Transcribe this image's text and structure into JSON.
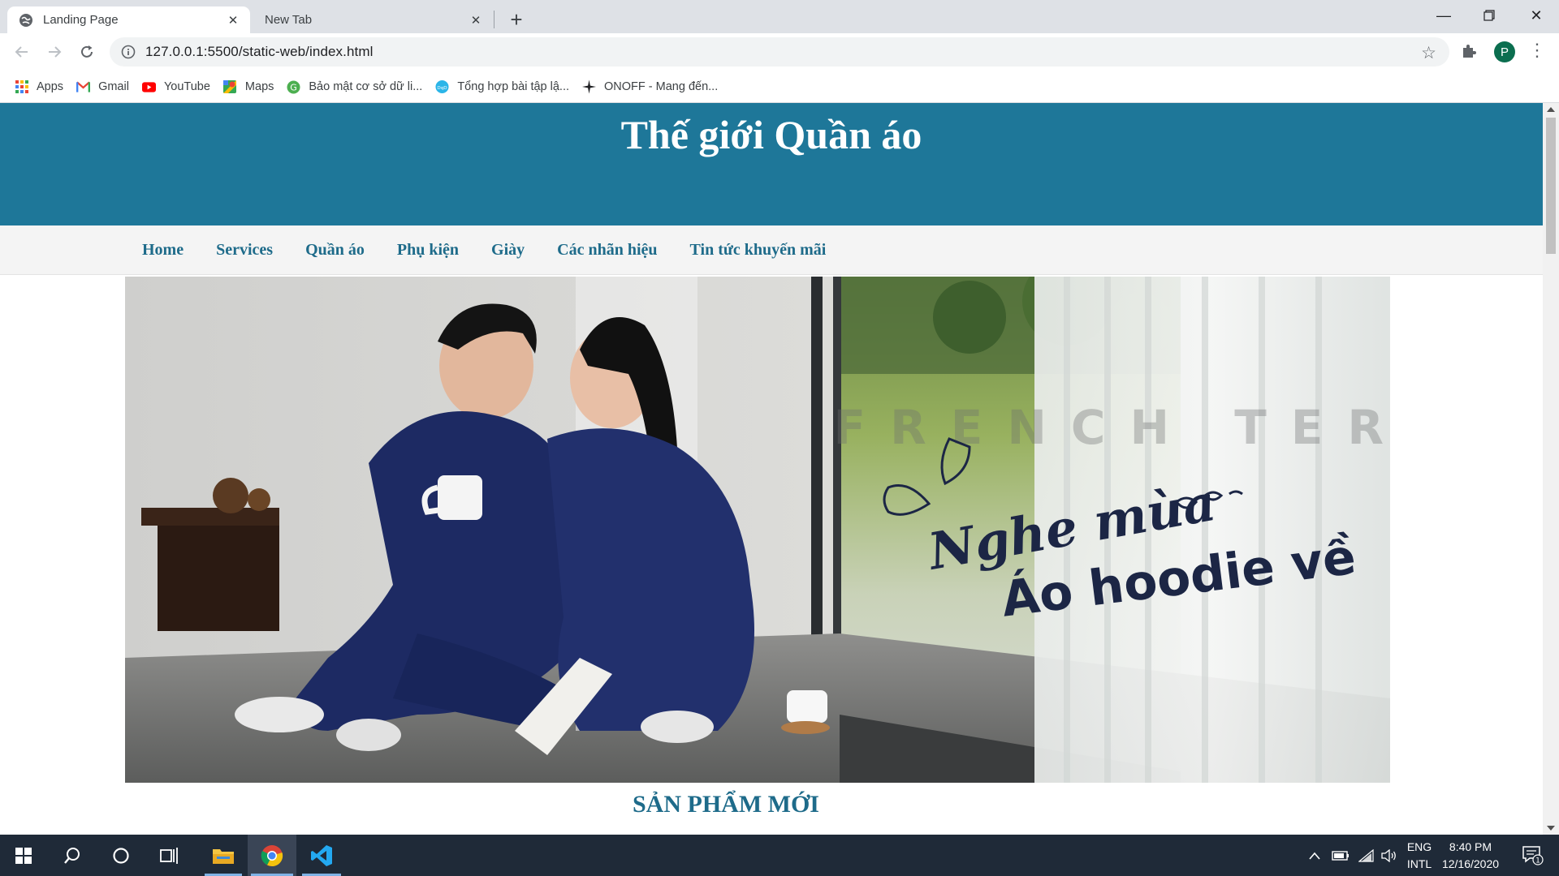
{
  "browser": {
    "tabs": [
      {
        "title": "Landing Page",
        "active": true
      },
      {
        "title": "New Tab",
        "active": false
      }
    ],
    "address_url": "127.0.0.1:5500/static-web/index.html",
    "profile_initial": "P",
    "bookmarks": [
      {
        "label": "Apps",
        "icon": "apps-grid-icon"
      },
      {
        "label": "Gmail",
        "icon": "gmail-icon"
      },
      {
        "label": "YouTube",
        "icon": "youtube-icon"
      },
      {
        "label": "Maps",
        "icon": "maps-icon"
      },
      {
        "label": "Bảo mật cơ sở dữ li...",
        "icon": "green-g-icon"
      },
      {
        "label": "Tổng hợp bài tập lậ...",
        "icon": "blue-circle-icon"
      },
      {
        "label": "ONOFF - Mang đến...",
        "icon": "plane-icon"
      }
    ]
  },
  "page": {
    "site_title": "Thế giới Quần áo",
    "nav": [
      "Home",
      "Services",
      "Quần áo",
      "Phụ kiện",
      "Giày",
      "Các nhãn hiệu",
      "Tin tức khuyến mãi"
    ],
    "banner": {
      "watermark": "FRENCH TERRY",
      "script_text": "Nghe mùa",
      "headline": "Áo hoodie về"
    },
    "section_heading": "SẢN PHẨM MỚI"
  },
  "taskbar": {
    "language_top": "ENG",
    "language_bottom": "INTL",
    "time": "8:40 PM",
    "date": "12/16/2020",
    "notification_count": "1"
  },
  "colors": {
    "header_blue": "#1e7799",
    "nav_text": "#1e6b8a",
    "taskbar": "#1f2a38"
  }
}
